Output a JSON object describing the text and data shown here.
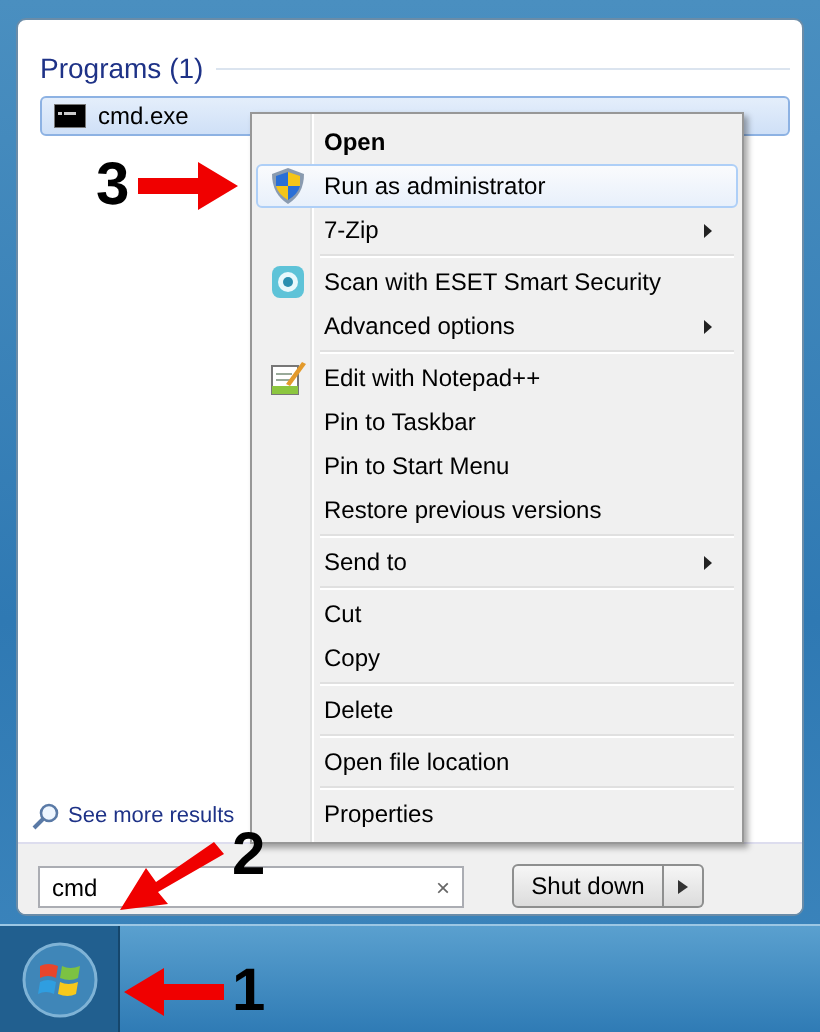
{
  "programs_header": "Programs (1)",
  "program_results": [
    {
      "label": "cmd.exe",
      "selected": true
    }
  ],
  "see_more": "See more results",
  "search": {
    "value": "cmd",
    "clear": "×"
  },
  "shutdown": {
    "label": "Shut down"
  },
  "context_menu": {
    "items": [
      {
        "kind": "plain",
        "label": "Open",
        "bold": true,
        "highlighted": false,
        "submenu": false
      },
      {
        "kind": "shield",
        "label": "Run as administrator",
        "bold": false,
        "highlighted": true,
        "submenu": false
      },
      {
        "kind": "plain",
        "label": "7-Zip",
        "bold": false,
        "highlighted": false,
        "submenu": true
      },
      {
        "kind": "separator"
      },
      {
        "kind": "scan",
        "label": "Scan with ESET Smart Security",
        "bold": false,
        "highlighted": false,
        "submenu": false
      },
      {
        "kind": "plain",
        "label": "Advanced options",
        "bold": false,
        "highlighted": false,
        "submenu": true
      },
      {
        "kind": "separator"
      },
      {
        "kind": "notepad",
        "label": "Edit with Notepad++",
        "bold": false,
        "highlighted": false,
        "submenu": false
      },
      {
        "kind": "plain",
        "label": "Pin to Taskbar",
        "bold": false,
        "highlighted": false,
        "submenu": false
      },
      {
        "kind": "plain",
        "label": "Pin to Start Menu",
        "bold": false,
        "highlighted": false,
        "submenu": false
      },
      {
        "kind": "plain",
        "label": "Restore previous versions",
        "bold": false,
        "highlighted": false,
        "submenu": false
      },
      {
        "kind": "separator"
      },
      {
        "kind": "plain",
        "label": "Send to",
        "bold": false,
        "highlighted": false,
        "submenu": true
      },
      {
        "kind": "separator"
      },
      {
        "kind": "plain",
        "label": "Cut",
        "bold": false,
        "highlighted": false,
        "submenu": false
      },
      {
        "kind": "plain",
        "label": "Copy",
        "bold": false,
        "highlighted": false,
        "submenu": false
      },
      {
        "kind": "separator"
      },
      {
        "kind": "plain",
        "label": "Delete",
        "bold": false,
        "highlighted": false,
        "submenu": false
      },
      {
        "kind": "separator"
      },
      {
        "kind": "plain",
        "label": "Open file location",
        "bold": false,
        "highlighted": false,
        "submenu": false
      },
      {
        "kind": "separator"
      },
      {
        "kind": "plain",
        "label": "Properties",
        "bold": false,
        "highlighted": false,
        "submenu": false
      }
    ]
  },
  "callouts": [
    {
      "number": "3"
    },
    {
      "number": "2"
    },
    {
      "number": "1"
    }
  ]
}
